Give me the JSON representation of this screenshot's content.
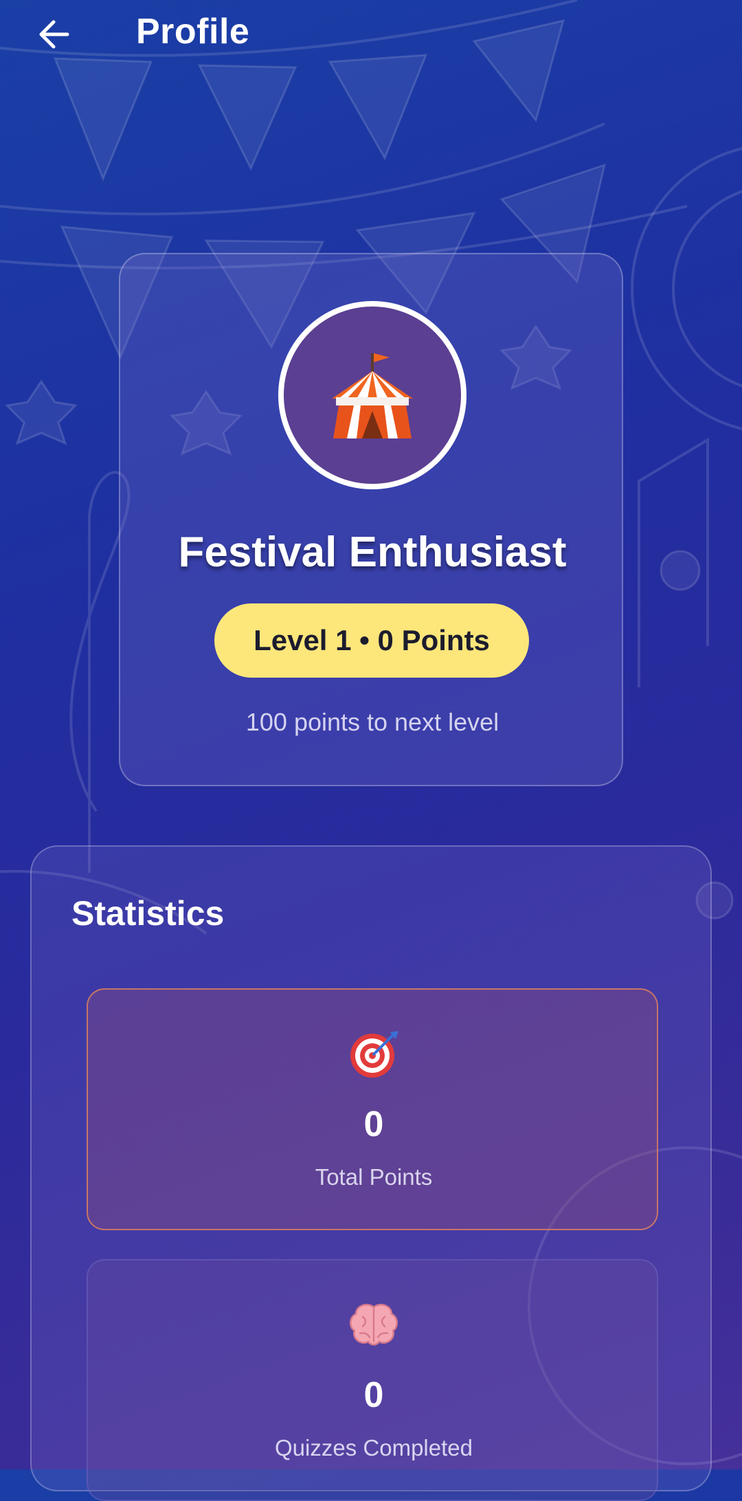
{
  "header": {
    "title": "Profile",
    "back_icon": "arrow-left-icon"
  },
  "profile": {
    "avatar_icon": "circus-tent-icon",
    "name": "Festival Enthusiast",
    "level_badge": "Level 1 • 0 Points",
    "next_level_text": "100 points to next level"
  },
  "statistics": {
    "title": "Statistics",
    "items": [
      {
        "icon": "target-icon",
        "value": "0",
        "label": "Total Points"
      },
      {
        "icon": "brain-icon",
        "value": "0",
        "label": "Quizzes Completed"
      }
    ]
  },
  "colors": {
    "background_top": "#1a3fa6",
    "background_bottom": "#46309a",
    "badge": "#fde67a",
    "avatar_bg": "#5b3f92",
    "points_border": "#ec8a58"
  }
}
